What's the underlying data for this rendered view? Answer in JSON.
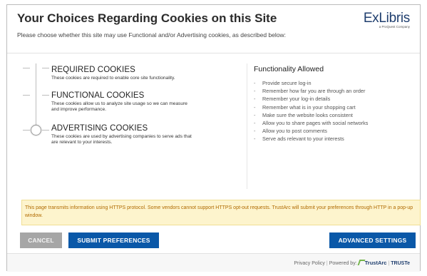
{
  "dialog": {
    "title": "Your Choices Regarding Cookies on this Site",
    "subtitle": "Please choose whether this site may use Functional and/or Advertising cookies, as described below:",
    "logo": {
      "name": "ExLibris",
      "tagline": "a ProQuest Company"
    }
  },
  "levels": [
    {
      "title": "REQUIRED COOKIES",
      "description": "These cookies are required to enable core site functionality."
    },
    {
      "title": "FUNCTIONAL COOKIES",
      "description": "These cookies allow us to analyze site usage so we can measure and improve performance."
    },
    {
      "title": "ADVERTISING COOKIES",
      "description": "These cookies are used by advertising companies to serve ads that are relevant to your interests."
    }
  ],
  "selected_level": "ADVERTISING COOKIES",
  "functionality": {
    "heading": "Functionality Allowed",
    "items": [
      "Provide secure log-in",
      "Remember how far you are through an order",
      "Remember your log-in details",
      "Remember what is in your shopping cart",
      "Make sure the website looks consistent",
      "Allow you to share pages with social networks",
      "Allow you to post comments",
      "Serve ads relevant to your interests"
    ]
  },
  "notice": "This page transmits information using HTTPS protocol. Some vendors cannot support HTTPS opt-out requests. TrustArc will submit your preferences through HTTP in a pop-up window.",
  "buttons": {
    "cancel": "CANCEL",
    "submit": "SUBMIT PREFERENCES",
    "advanced": "ADVANCED SETTINGS"
  },
  "footer": {
    "privacy_policy": "Privacy Policy",
    "powered_by": "Powered by:",
    "trustarc": "TrustArc",
    "truste": "TRUSTe"
  },
  "colors": {
    "primary_button": "#0a58a8",
    "cancel_button": "#a6a6a6",
    "notice_bg": "#fdf4cd",
    "notice_text": "#b06a00"
  }
}
